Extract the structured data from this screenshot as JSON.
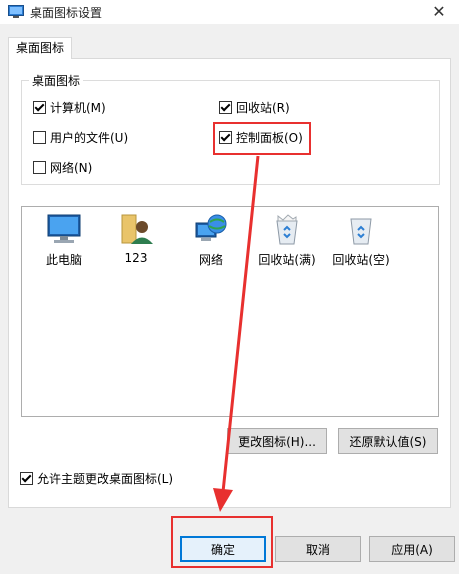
{
  "window": {
    "title": "桌面图标设置",
    "close_glyph": "✕"
  },
  "tab": {
    "label": "桌面图标"
  },
  "group": {
    "legend": "桌面图标",
    "checkboxes": [
      {
        "label": "计算机(M)",
        "checked": true
      },
      {
        "label": "回收站(R)",
        "checked": true
      },
      {
        "label": "用户的文件(U)",
        "checked": false
      },
      {
        "label": "控制面板(O)",
        "checked": true
      },
      {
        "label": "网络(N)",
        "checked": false
      }
    ]
  },
  "icons": [
    {
      "label": "此电脑",
      "icon": "monitor-icon"
    },
    {
      "label": "123",
      "icon": "user-folder-icon"
    },
    {
      "label": "网络",
      "icon": "network-globe-icon"
    },
    {
      "label": "回收站(满)",
      "icon": "recycle-bin-full-icon"
    },
    {
      "label": "回收站(空)",
      "icon": "recycle-bin-empty-icon"
    }
  ],
  "buttons": {
    "change_icon": "更改图标(H)...",
    "restore_default": "还原默认值(S)",
    "ok": "确定",
    "cancel": "取消",
    "apply": "应用(A)"
  },
  "allow_theme": {
    "label": "允许主题更改桌面图标(L)",
    "checked": true
  },
  "annotation": {
    "color": "#e8302f"
  }
}
